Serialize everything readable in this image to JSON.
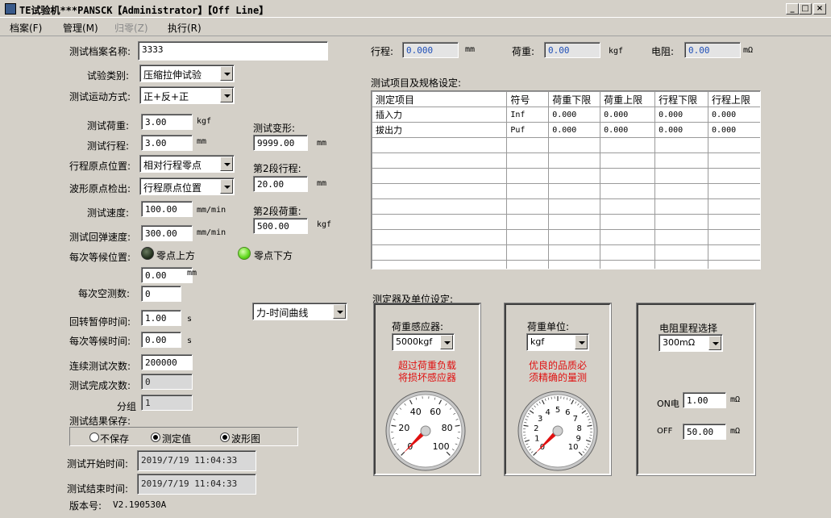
{
  "window": {
    "title": "TE试验机***PANSCK【Administrator】【Off Line】",
    "min_label": "_",
    "max_label": "□",
    "close_label": "×"
  },
  "menu": [
    {
      "label": "档案(F)",
      "enabled": true
    },
    {
      "label": "管理(M)",
      "enabled": true
    },
    {
      "label": "归零(Z)",
      "enabled": false
    },
    {
      "label": "执行(R)",
      "enabled": true
    }
  ],
  "form": {
    "file_name_label": "测试档案名称:",
    "file_name_value": "3333",
    "test_type_label": "试验类别:",
    "test_type_value": "压缩拉伸试验",
    "motion_label": "测试运动方式:",
    "motion_value": "正+反+正",
    "load_label": "测试荷重:",
    "load_value": "3.00",
    "load_unit": "kgf",
    "stroke_label": "测试行程:",
    "stroke_value": "3.00",
    "stroke_unit": "mm",
    "origin_label": "行程原点位置:",
    "origin_value": "相对行程零点",
    "wave_origin_label": "波形原点检出:",
    "wave_origin_value": "行程原点位置",
    "speed_label": "测试速度:",
    "speed_value": "100.00",
    "speed_unit": "mm/min",
    "return_speed_label": "测试回弹速度:",
    "return_speed_value": "300.00",
    "return_speed_unit": "mm/min",
    "wait_pos_label": "每次等候位置:",
    "zero_above_label": "零点上方",
    "zero_below_label": "零点下方",
    "wait_offset_value": "0.00",
    "wait_offset_unit": "mm",
    "idle_count_label": "每次空测数:",
    "idle_count_value": "0",
    "pause_label": "回转暂停时间:",
    "pause_value": "1.00",
    "pause_unit": "s",
    "wait_time_label": "每次等候时间:",
    "wait_time_value": "0.00",
    "wait_time_unit": "s",
    "continuous_label": "连续测试次数:",
    "continuous_value": "200000",
    "done_label": "测试完成次数:",
    "done_value": "0",
    "group_label": "分组",
    "group_value": "1",
    "save_label": "测试结果保存:",
    "save_options": [
      "不保存",
      "测定值",
      "波形图"
    ],
    "start_label": "测试开始时间:",
    "start_value": "2019/7/19 11:04:33",
    "end_label": "测试结束时间:",
    "end_value": "2019/7/19 11:04:33",
    "version_label": "版本号:",
    "version_value": "V2.190530A"
  },
  "mid": {
    "deform_label": "测试变形:",
    "deform_value": "9999.00",
    "deform_unit": "mm",
    "stage2_stroke_label": "第2段行程:",
    "stage2_stroke_value": "20.00",
    "stage2_stroke_unit": "mm",
    "stage2_load_label": "第2段荷重:",
    "stage2_load_value": "500.00",
    "stage2_load_unit": "kgf",
    "curve_value": "力-时间曲线"
  },
  "readout": {
    "stroke_label": "行程:",
    "stroke_value": "0.000",
    "stroke_unit": "mm",
    "load_label": "荷重:",
    "load_value": "0.00",
    "load_unit": "kgf",
    "res_label": "电阻:",
    "res_value": "0.00",
    "res_unit": "mΩ"
  },
  "spec": {
    "title": "测试项目及规格设定:",
    "headers": [
      "测定项目",
      "符号",
      "荷重下限",
      "荷重上限",
      "行程下限",
      "行程上限"
    ],
    "rows": [
      [
        "插入力",
        "Inf",
        "0.000",
        "0.000",
        "0.000",
        "0.000"
      ],
      [
        "拔出力",
        "Puf",
        "0.000",
        "0.000",
        "0.000",
        "0.000"
      ]
    ]
  },
  "sensor": {
    "title": "测定器及单位设定:",
    "load_sensor_label": "荷重感应器:",
    "load_sensor_value": "5000kgf",
    "warning_line1": "超过荷重负载",
    "warning_line2": "将损坏感应器",
    "unit_label": "荷重单位:",
    "unit_value": "kgf",
    "quality_line1": "优良的品质必",
    "quality_line2": "须精确的量测",
    "res_range_label": "电阻里程选择",
    "res_range_value": "300mΩ",
    "on_label": "ON电",
    "on_value": "1.00",
    "on_unit": "mΩ",
    "off_label": "OFF",
    "off_value": "50.00",
    "off_unit": "mΩ",
    "gauge1": {
      "ticks": [
        "0",
        "20",
        "40",
        "60",
        "80",
        "100"
      ],
      "value": 0
    },
    "gauge2": {
      "ticks": [
        "0",
        "1",
        "2",
        "3",
        "4",
        "5",
        "6",
        "7",
        "8",
        "9",
        "10"
      ],
      "value": 0
    }
  }
}
